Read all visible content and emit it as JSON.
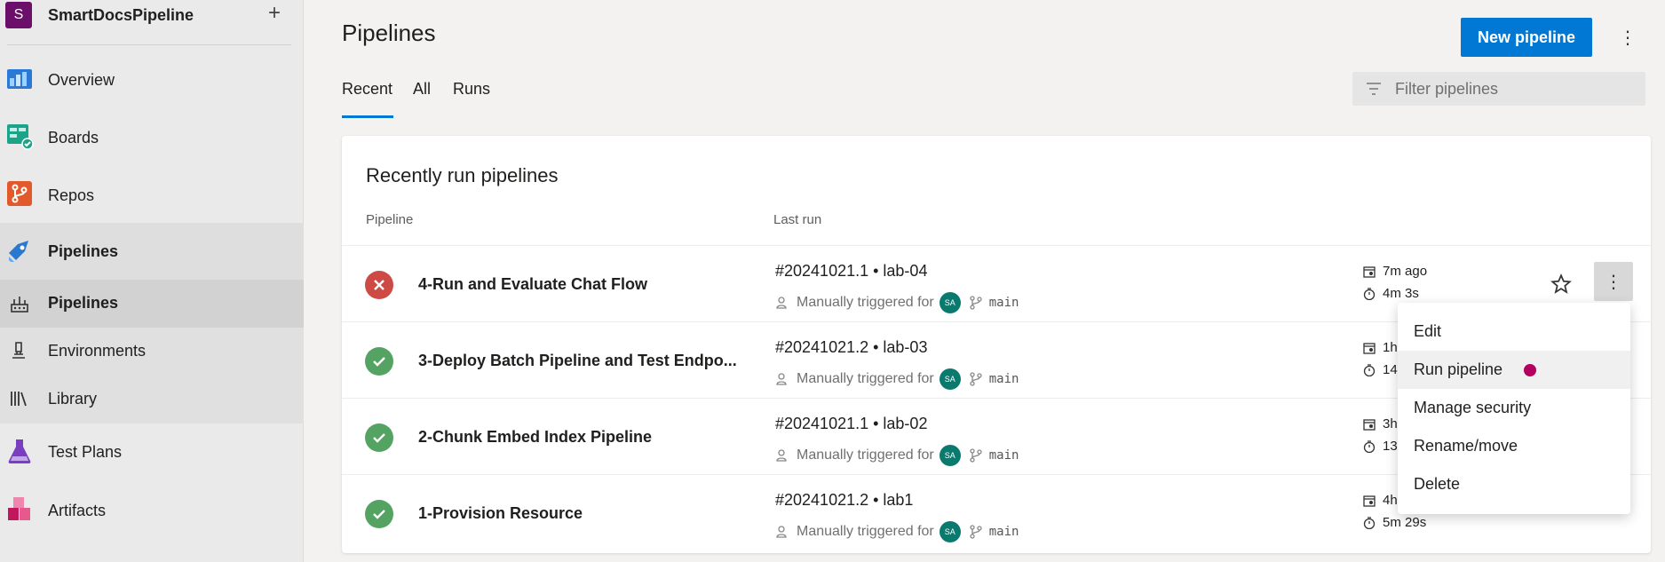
{
  "sidebar": {
    "project": {
      "initial": "S",
      "name": "SmartDocsPipeline",
      "add_label": "+"
    },
    "items": [
      {
        "label": "Overview",
        "icon": "overview-icon"
      },
      {
        "label": "Boards",
        "icon": "boards-icon"
      },
      {
        "label": "Repos",
        "icon": "repos-icon"
      },
      {
        "label": "Pipelines",
        "icon": "pipelines-icon"
      },
      {
        "label": "Pipelines",
        "icon": "pipelines-sub-icon"
      },
      {
        "label": "Environments",
        "icon": "environments-icon"
      },
      {
        "label": "Library",
        "icon": "library-icon"
      },
      {
        "label": "Test Plans",
        "icon": "test-plans-icon"
      },
      {
        "label": "Artifacts",
        "icon": "artifacts-icon"
      }
    ]
  },
  "header": {
    "title": "Pipelines",
    "new_button": "New pipeline",
    "more": "⋮"
  },
  "tabs": [
    {
      "label": "Recent",
      "active": true
    },
    {
      "label": "All",
      "active": false
    },
    {
      "label": "Runs",
      "active": false
    }
  ],
  "filter": {
    "placeholder": "Filter pipelines"
  },
  "card": {
    "title": "Recently run pipelines",
    "columns": {
      "pipeline": "Pipeline",
      "last_run": "Last run"
    },
    "rows": [
      {
        "status": "failed",
        "name": "4-Run and Evaluate Chat Flow",
        "run": "#20241021.1 • lab-04",
        "trigger": "Manually triggered for",
        "user_initials": "SA",
        "branch": "main",
        "ago": "7m ago",
        "duration": "4m 3s"
      },
      {
        "status": "succeeded",
        "name": "3-Deploy Batch Pipeline and Test Endpo...",
        "run": "#20241021.2 • lab-03",
        "trigger": "Manually triggered for",
        "user_initials": "SA",
        "branch": "main",
        "ago": "1h",
        "duration": "14"
      },
      {
        "status": "succeeded",
        "name": "2-Chunk Embed Index Pipeline",
        "run": "#20241021.1 • lab-02",
        "trigger": "Manually triggered for",
        "user_initials": "SA",
        "branch": "main",
        "ago": "3h",
        "duration": "13"
      },
      {
        "status": "succeeded",
        "name": "1-Provision Resource",
        "run": "#20241021.2 • lab1",
        "trigger": "Manually triggered for",
        "user_initials": "SA",
        "branch": "main",
        "ago": "4h",
        "duration": "5m 29s"
      }
    ]
  },
  "context_menu": {
    "items": [
      "Edit",
      "Run pipeline",
      "Manage security",
      "Rename/move",
      "Delete"
    ]
  },
  "colors": {
    "accent": "#0078d4",
    "failed": "#cd4a45",
    "succeeded": "#55a362",
    "avatar": "#0b7a6e",
    "indicator": "#b4005f"
  }
}
